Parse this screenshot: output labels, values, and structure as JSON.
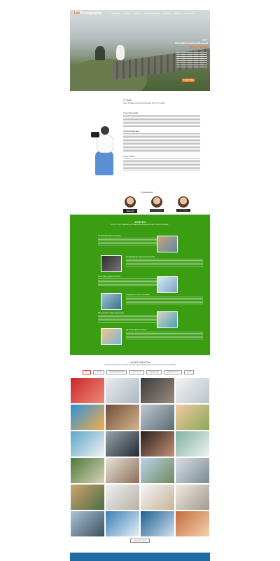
{
  "header": {
    "logo_accent": "i.sv",
    "logo_text": "Photography",
    "nav": [
      "ГЛАВНАЯ",
      "О НАС",
      "УСЛУГИ",
      "ФОТОГАЛЕРЕЯ",
      "ОТЗЫВЫ",
      "ЦЕНЫ",
      "КОНТАКТЫ"
    ],
    "hero_line1": "МЫ",
    "hero_line2": "ПРОФЕССИОНАЛЬНЫЕ",
    "hero_line3": "ФОТОГРАФЫ",
    "hero_button": "ПОДРОБНЕЕ"
  },
  "about": {
    "title": "О НАС",
    "subtitle": "Мы ПРОФЕССИОНАЛЬНЫЕ ФОТОГРАФЫ",
    "paragraphs": [
      {
        "title": "Олег Пронский"
      },
      {
        "title": "Юлия Фёдорова"
      },
      {
        "title": "Олег Зубов"
      }
    ],
    "signature": "С уважением,",
    "members": [
      "Александр Прокопенко",
      "Никита Фёдорова",
      "Ольга Зубова"
    ]
  },
  "services": {
    "title": "УСЛУГИ",
    "subtitle": "ПУСТЬ СЧАСТЛИВЫЕ МГНОВЕНИЯ ЗАПЕЧАТЛЕНЫ НА ВСЮ ЖИЗНЬ...",
    "items": [
      "Семейная фотосъемка",
      "Индивидуальная фотосессия",
      "Love Story фотосессия",
      "Свадебная фотосъемка",
      "Фотосессия беременности",
      "Детская фотосъемка"
    ]
  },
  "works": {
    "title": "НАШИ РАБОТЫ",
    "subtitle": "ЛУЧШИЕ МОМЕНТЫ ВАШЕЙ ЖИЗНИ МЫ ПРЕВРАЩАЕМ В КЛАССНЫЕ ФОТОГРАФИИ",
    "filters": [
      "ВСЕ",
      "СЕМЬЯ",
      "ИНДИВИДУАЛЬНАЯ",
      "LOVE STORY",
      "СВАДЕБНАЯ",
      "БЕРЕМЕННОСТЬ",
      "ДЕТИ"
    ],
    "more_button": "ЗАГРУЗИТЬ ЕЩЁ"
  },
  "colors": {
    "accent": "#f07e1a",
    "services_bg": "#3a9d12",
    "footer": "#1e6aa3"
  }
}
